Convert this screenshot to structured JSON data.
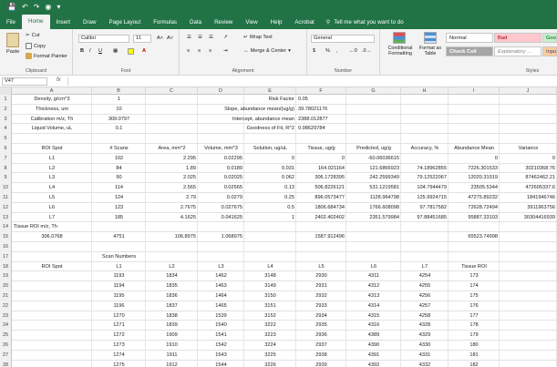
{
  "title_bar": {
    "quick_access": [
      "save-icon",
      "undo-icon",
      "redo-icon",
      "camera-icon",
      "customize-icon"
    ]
  },
  "tabs": [
    "File",
    "Home",
    "Insert",
    "Draw",
    "Page Layout",
    "Formulas",
    "Data",
    "Review",
    "View",
    "Help",
    "Acrobat"
  ],
  "active_tab": "Home",
  "tell_me": "Tell me what you want to do",
  "ribbon": {
    "clipboard": {
      "paste": "Paste",
      "cut": "Cut",
      "copy": "Copy",
      "format_painter": "Format Painter",
      "label": "Clipboard"
    },
    "font": {
      "name": "Calibri",
      "size": "11",
      "bold": "B",
      "italic": "I",
      "underline": "U",
      "label": "Font"
    },
    "alignment": {
      "wrap_text": "Wrap Text",
      "merge_center": "Merge & Center",
      "label": "Alignment"
    },
    "number": {
      "format": "General",
      "currency": "$",
      "percent": "%",
      "comma": ",",
      "label": "Number"
    },
    "styles": {
      "conditional_formatting": "Conditional Formatting",
      "format_as_table": "Format as Table",
      "normal": "Normal",
      "bad": "Bad",
      "good": "Goo",
      "neutral": "Neutral",
      "check_cell": "Check Cell",
      "explanatory": "Explanatory ...",
      "input": "Inpu",
      "label": "Styles"
    }
  },
  "formula_bar": {
    "name_box": "V47",
    "fx": "fx",
    "content": ""
  },
  "columns": [
    "A",
    "B",
    "C",
    "D",
    "E",
    "F",
    "G",
    "H",
    "I",
    "J"
  ],
  "rows": [
    {
      "n": "1",
      "cells": {
        "A": "Density, g/cm^3",
        "B": "1",
        "E": "Risk Factor",
        "F": "0.05"
      }
    },
    {
      "n": "2",
      "cells": {
        "A": "Thickness, um",
        "B": "10",
        "E": "Slope, abundance mean/(ug/g)",
        "F": "39.78021176"
      }
    },
    {
      "n": "3",
      "cells": {
        "A": "Calibration m/z, Th",
        "B": "309.0797",
        "E": "Intercept, abundance mean",
        "F": "2388.012877"
      }
    },
    {
      "n": "4",
      "cells": {
        "A": "Liquid Volume, uL",
        "B": "0.1",
        "E": "Goodness of Fit, R^2",
        "F": "0.98629784"
      }
    },
    {
      "n": "5",
      "cells": {}
    },
    {
      "n": "6",
      "cells": {
        "A": "ROI Spot",
        "B": "# Scans",
        "C": "Area, mm^2",
        "D": "Volume, mm^3",
        "E": "Solution, ug/uL",
        "F": "Tissue, ug/g",
        "G": "Predicted, ug/g",
        "H": "Accuracy, %",
        "I": "Abundance Mean",
        "J": "Variance"
      }
    },
    {
      "n": "7",
      "cells": {
        "A": "L1",
        "B": "102",
        "C": "2.295",
        "D": "0.02295",
        "E": "0",
        "F": "0",
        "G": "-60.06036615",
        "H": "",
        "I": "0",
        "J": "0"
      }
    },
    {
      "n": "8",
      "cells": {
        "A": "L2",
        "B": "84",
        "C": "1.89",
        "D": "0.0189",
        "E": "0.031",
        "F": "164.021164",
        "G": "121.6866923",
        "H": "74.18962855",
        "I": "7226.301533",
        "J": "30210368.76"
      }
    },
    {
      "n": "9",
      "cells": {
        "A": "L3",
        "B": "90",
        "C": "2.025",
        "D": "0.02025",
        "E": "0.062",
        "F": "306.1728395",
        "G": "242.2599349",
        "H": "79.12522067",
        "I": "12020.31919",
        "J": "87462462.21"
      }
    },
    {
      "n": "10",
      "cells": {
        "A": "L4",
        "B": "114",
        "C": "2.565",
        "D": "0.02565",
        "E": "0.13",
        "F": "506.8226121",
        "G": "531.1219581",
        "H": "104.7944479",
        "I": "23505.5344",
        "J": "472605337.6"
      }
    },
    {
      "n": "11",
      "cells": {
        "A": "L5",
        "B": "124",
        "C": "2.79",
        "D": "0.0279",
        "E": "0.25",
        "F": "896.0573477",
        "G": "1128.964798",
        "H": "125.9924715",
        "I": "47275.89232",
        "J": "1841946746"
      }
    },
    {
      "n": "12",
      "cells": {
        "A": "L6",
        "B": "123",
        "C": "2.7675",
        "D": "0.027675",
        "E": "0.5",
        "F": "1806.684734",
        "G": "1766.608098",
        "H": "97.7817582",
        "I": "72628.72494",
        "J": "3911963756"
      }
    },
    {
      "n": "13",
      "cells": {
        "A": "L7",
        "B": "185",
        "C": "4.1625",
        "D": "0.041625",
        "E": "1",
        "F": "2402.402402",
        "G": "2351.579984",
        "H": "97.88451685",
        "I": "95887.33103",
        "J": "30304416939"
      }
    },
    {
      "n": "14",
      "cells": {
        "A": "Tissue ROI m/z, Th"
      }
    },
    {
      "n": "15",
      "cells": {
        "A": "306.0768",
        "B": "4751",
        "C": "106.8975",
        "D": "1.068975",
        "F": "1587.912496",
        "I": "65523.74998"
      }
    },
    {
      "n": "16",
      "cells": {}
    },
    {
      "n": "17",
      "cells": {
        "B": "Scan Numbers"
      }
    },
    {
      "n": "18",
      "cells": {
        "A": "ROI Spot",
        "B": "L1",
        "C": "L2",
        "D": "L3",
        "E": "L4",
        "F": "L5",
        "G": "L6",
        "H": "L7",
        "I": "Tissue ROI"
      }
    },
    {
      "n": "19",
      "cells": {
        "B": "1193",
        "C": "1834",
        "D": "1462",
        "E": "3148",
        "F": "2930",
        "G": "4311",
        "H": "4254",
        "I": "173"
      }
    },
    {
      "n": "20",
      "cells": {
        "B": "1194",
        "C": "1835",
        "D": "1463",
        "E": "3149",
        "F": "2931",
        "G": "4312",
        "H": "4255",
        "I": "174"
      }
    },
    {
      "n": "21",
      "cells": {
        "B": "1195",
        "C": "1836",
        "D": "1464",
        "E": "3150",
        "F": "2932",
        "G": "4313",
        "H": "4256",
        "I": "175"
      }
    },
    {
      "n": "22",
      "cells": {
        "B": "1196",
        "C": "1837",
        "D": "1465",
        "E": "3151",
        "F": "2933",
        "G": "4314",
        "H": "4257",
        "I": "176"
      }
    },
    {
      "n": "23",
      "cells": {
        "B": "1270",
        "C": "1838",
        "D": "1539",
        "E": "3152",
        "F": "2934",
        "G": "4315",
        "H": "4258",
        "I": "177"
      }
    },
    {
      "n": "24",
      "cells": {
        "B": "1271",
        "C": "1839",
        "D": "1540",
        "E": "3222",
        "F": "2935",
        "G": "4316",
        "H": "4328",
        "I": "178"
      }
    },
    {
      "n": "25",
      "cells": {
        "B": "1272",
        "C": "1909",
        "D": "1541",
        "E": "3223",
        "F": "2936",
        "G": "4389",
        "H": "4329",
        "I": "179"
      }
    },
    {
      "n": "26",
      "cells": {
        "B": "1273",
        "C": "1910",
        "D": "1542",
        "E": "3224",
        "F": "2937",
        "G": "4390",
        "H": "4330",
        "I": "180"
      }
    },
    {
      "n": "27",
      "cells": {
        "B": "1274",
        "C": "1911",
        "D": "1543",
        "E": "3225",
        "F": "2938",
        "G": "4391",
        "H": "4331",
        "I": "181"
      }
    },
    {
      "n": "28",
      "cells": {
        "B": "1275",
        "C": "1912",
        "D": "1544",
        "E": "3226",
        "F": "2939",
        "G": "4392",
        "H": "4332",
        "I": "182"
      }
    },
    {
      "n": "29",
      "cells": {
        "B": "1346",
        "C": "1913",
        "D": "1616",
        "E": "3227",
        "F": "3008",
        "G": "4393",
        "H": "4333",
        "I": "183"
      }
    }
  ],
  "colors": {
    "excel_green": "#217346",
    "bad_bg": "#ffc7ce",
    "bad_fg": "#9c0006",
    "good_bg": "#c6efce",
    "good_fg": "#006100",
    "neutral_bg": "#ffeb9c",
    "neutral_fg": "#9c5700",
    "check_bg": "#a5a5a5",
    "input_bg": "#ffcc99"
  }
}
